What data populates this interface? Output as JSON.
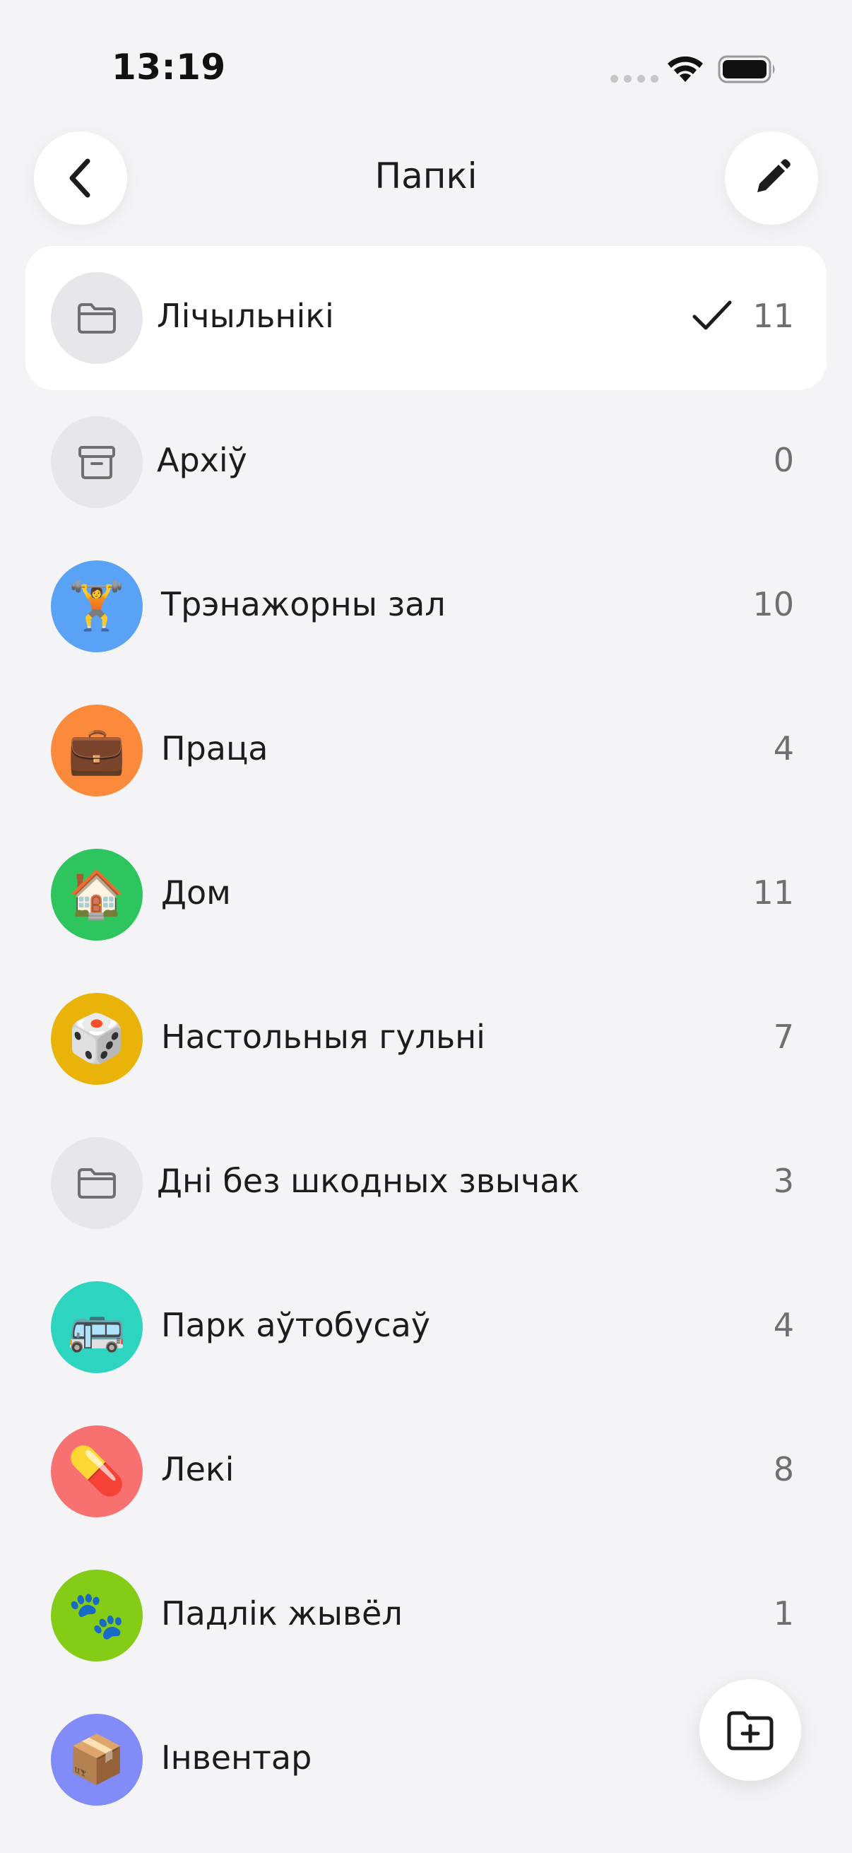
{
  "status_bar": {
    "time": "13:19"
  },
  "header": {
    "title": "Папкі"
  },
  "folders": [
    {
      "name": "Лічыльнікі",
      "count": "11",
      "icon": "folder-icon",
      "emoji": "",
      "color": "#e6e6eb",
      "selected": true
    },
    {
      "name": "Архіў",
      "count": "0",
      "icon": "archive-box-icon",
      "emoji": "",
      "color": "#e6e6eb",
      "selected": false
    },
    {
      "name": "Трэнажорны зал",
      "count": "10",
      "icon": "weightlifter-emoji-icon",
      "emoji": "🏋️",
      "color": "#5aa2f5",
      "selected": false
    },
    {
      "name": "Праца",
      "count": "4",
      "icon": "briefcase-emoji-icon",
      "emoji": "💼",
      "color": "#fb8a3c",
      "selected": false
    },
    {
      "name": "Дом",
      "count": "11",
      "icon": "house-emoji-icon",
      "emoji": "🏠",
      "color": "#2ec55e",
      "selected": false
    },
    {
      "name": "Настольныя гульні",
      "count": "7",
      "icon": "dice-emoji-icon",
      "emoji": "🎲",
      "color": "#eab309",
      "selected": false
    },
    {
      "name": "Дні без шкодных звычак",
      "count": "3",
      "icon": "folder-icon",
      "emoji": "",
      "color": "#e6e6eb",
      "selected": false
    },
    {
      "name": "Парк аўтобусаў",
      "count": "4",
      "icon": "bus-emoji-icon",
      "emoji": "🚌",
      "color": "#2dd4bf",
      "selected": false
    },
    {
      "name": "Лекі",
      "count": "8",
      "icon": "pill-emoji-icon",
      "emoji": "💊",
      "color": "#f87171",
      "selected": false
    },
    {
      "name": "Падлік жывёл",
      "count": "1",
      "icon": "paw-prints-emoji-icon",
      "emoji": "🐾",
      "color": "#84cc16",
      "selected": false
    },
    {
      "name": "Інвентар",
      "count": "",
      "icon": "package-emoji-icon",
      "emoji": "📦",
      "color": "#818cf8",
      "selected": false
    }
  ],
  "accent": "#1c1c1e"
}
